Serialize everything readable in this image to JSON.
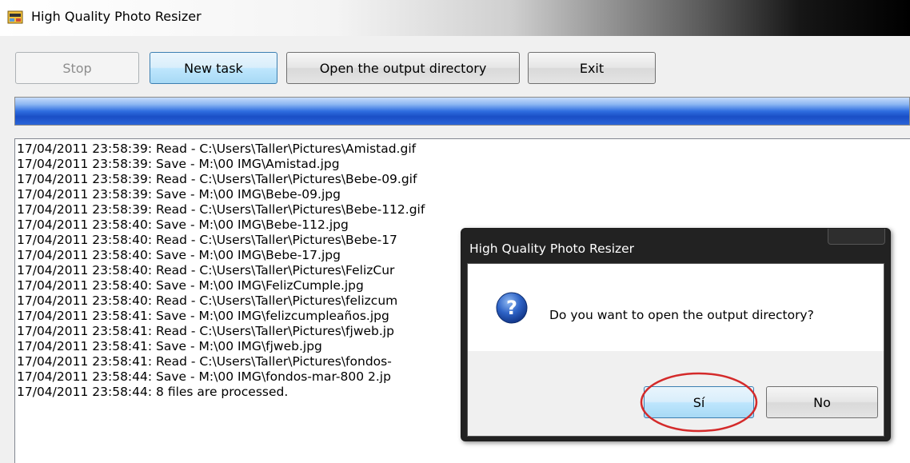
{
  "window": {
    "title": "High Quality Photo Resizer",
    "icon": "photo-resizer-app-icon"
  },
  "toolbar": {
    "stop_label": "Stop",
    "new_task_label": "New task",
    "open_output_label": "Open the output directory",
    "exit_label": "Exit"
  },
  "progress": {
    "value": 1.0,
    "color": "#1a4fc6"
  },
  "log": {
    "lines": [
      "17/04/2011 23:58:39: Read - C:\\Users\\Taller\\Pictures\\Amistad.gif",
      "17/04/2011 23:58:39: Save - M:\\00 IMG\\Amistad.jpg",
      "17/04/2011 23:58:39: Read - C:\\Users\\Taller\\Pictures\\Bebe-09.gif",
      "17/04/2011 23:58:39: Save - M:\\00 IMG\\Bebe-09.jpg",
      "17/04/2011 23:58:39: Read - C:\\Users\\Taller\\Pictures\\Bebe-112.gif",
      "17/04/2011 23:58:40: Save - M:\\00 IMG\\Bebe-112.jpg",
      "17/04/2011 23:58:40: Read - C:\\Users\\Taller\\Pictures\\Bebe-17",
      "17/04/2011 23:58:40: Save - M:\\00 IMG\\Bebe-17.jpg",
      "17/04/2011 23:58:40: Read - C:\\Users\\Taller\\Pictures\\FelizCur",
      "17/04/2011 23:58:40: Save - M:\\00 IMG\\FelizCumple.jpg",
      "17/04/2011 23:58:40: Read - C:\\Users\\Taller\\Pictures\\felizcum",
      "17/04/2011 23:58:41: Save - M:\\00 IMG\\felizcumpleaños.jpg",
      "17/04/2011 23:58:41: Read - C:\\Users\\Taller\\Pictures\\fjweb.jp",
      "17/04/2011 23:58:41: Save - M:\\00 IMG\\fjweb.jpg",
      "17/04/2011 23:58:41: Read - C:\\Users\\Taller\\Pictures\\fondos-",
      "17/04/2011 23:58:44: Save - M:\\00 IMG\\fondos-mar-800 2.jp",
      "17/04/2011 23:58:44: 8 files are processed."
    ]
  },
  "dialog": {
    "title": "High Quality Photo Resizer",
    "message": "Do you want to open the output directory?",
    "icon": "question-icon",
    "yes_label": "Sí",
    "no_label": "No",
    "highlight_color": "#d42a2a"
  }
}
